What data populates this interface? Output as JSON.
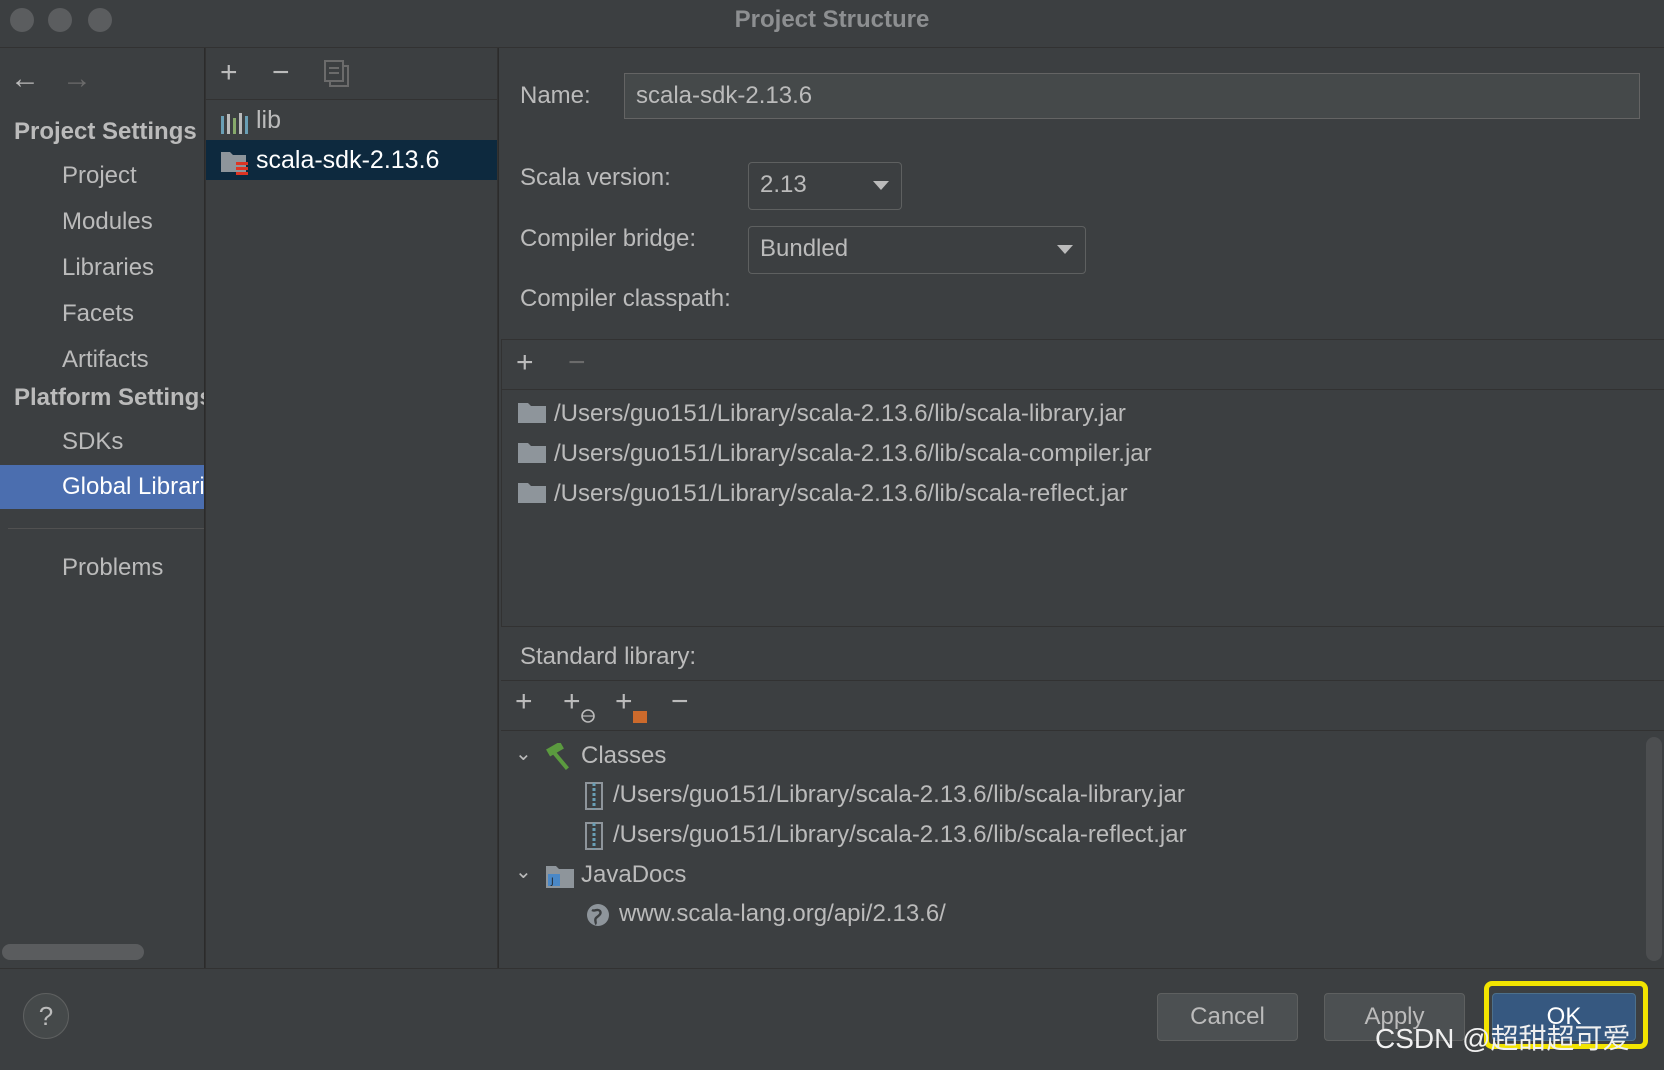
{
  "window": {
    "title": "Project Structure"
  },
  "nav": {
    "back": "←",
    "forward": "→",
    "project_settings_header": "Project Settings",
    "project_settings": [
      "Project",
      "Modules",
      "Libraries",
      "Facets",
      "Artifacts"
    ],
    "platform_settings_header": "Platform Settings",
    "platform_settings": [
      "SDKs",
      "Global Libraries"
    ],
    "problems": "Problems"
  },
  "libraries_panel": {
    "add": "+",
    "remove": "−",
    "items": [
      "lib",
      "scala-sdk-2.13.6"
    ],
    "selected": "scala-sdk-2.13.6"
  },
  "details": {
    "name_label": "Name:",
    "name_value": "scala-sdk-2.13.6",
    "scala_version_label": "Scala version:",
    "scala_version_value": "2.13",
    "compiler_bridge_label": "Compiler bridge:",
    "compiler_bridge_value": "Bundled",
    "compiler_classpath_label": "Compiler classpath:",
    "compiler_classpath_add": "+",
    "compiler_classpath_remove": "−",
    "compiler_classpath": [
      "/Users/guo151/Library/scala-2.13.6/lib/scala-library.jar",
      "/Users/guo151/Library/scala-2.13.6/lib/scala-compiler.jar",
      "/Users/guo151/Library/scala-2.13.6/lib/scala-reflect.jar"
    ],
    "standard_library_label": "Standard library:",
    "standard_library_toolbar": {
      "add": "+",
      "add_url": "+",
      "add_jar": "+",
      "remove": "−"
    },
    "classes_label": "Classes",
    "classes": [
      "/Users/guo151/Library/scala-2.13.6/lib/scala-library.jar",
      "/Users/guo151/Library/scala-2.13.6/lib/scala-reflect.jar"
    ],
    "javadocs_label": "JavaDocs",
    "javadocs": [
      "www.scala-lang.org/api/2.13.6/"
    ]
  },
  "buttons": {
    "help": "?",
    "cancel": "Cancel",
    "apply": "Apply",
    "ok": "OK"
  },
  "watermark": "CSDN @超甜超可爱",
  "colors": {
    "selection": "#4b6eaf",
    "tree_selection": "#0d293e",
    "ok_button": "#365880",
    "highlight": "#f2e400"
  }
}
